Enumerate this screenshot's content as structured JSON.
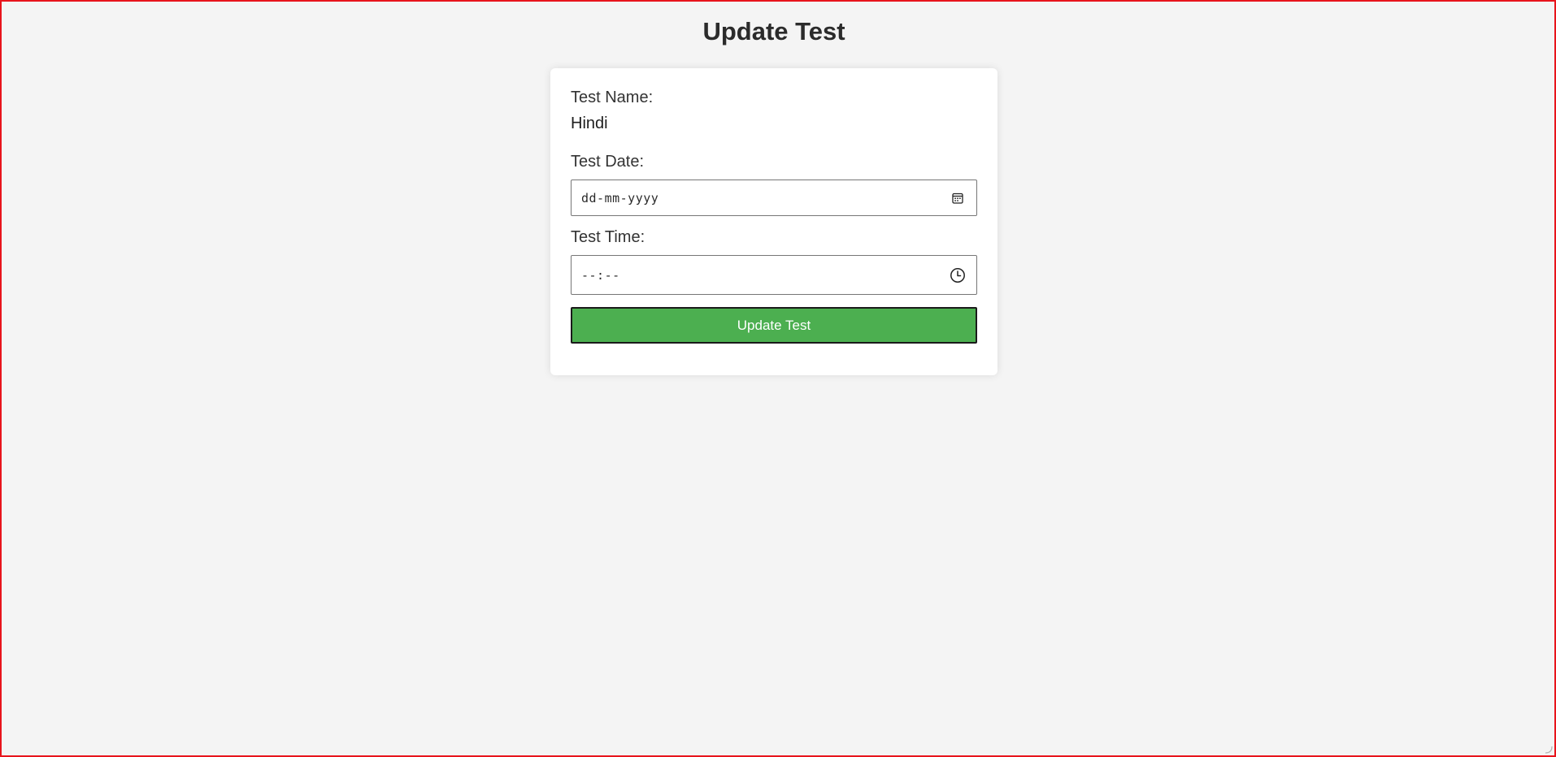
{
  "page": {
    "title": "Update Test"
  },
  "form": {
    "name_label": "Test Name:",
    "name_value": "Hindi",
    "date_label": "Test Date:",
    "date_placeholder": "dd-mm-yyyy",
    "date_icon": "calendar-icon",
    "time_label": "Test Time:",
    "time_placeholder": "--:--",
    "time_icon": "clock-icon",
    "submit_label": "Update Test"
  },
  "colors": {
    "background": "#f4f4f4",
    "card": "#ffffff",
    "button": "#4caf50",
    "button_text": "#ffffff",
    "frame": "#e8141c"
  }
}
